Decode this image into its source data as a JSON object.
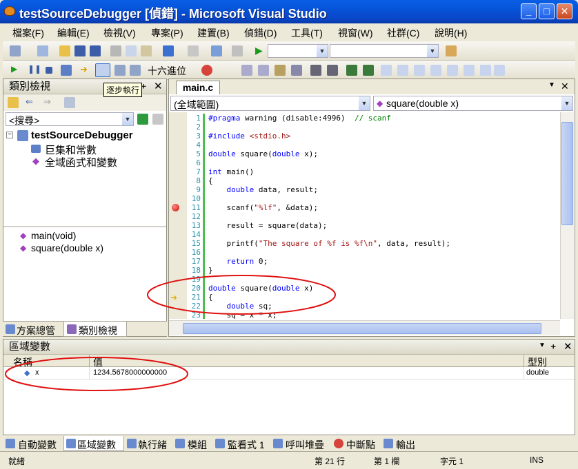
{
  "window": {
    "title": "testSourceDebugger [偵錯] - Microsoft Visual Studio"
  },
  "menu": [
    "檔案(F)",
    "編輯(E)",
    "檢視(V)",
    "專案(P)",
    "建置(B)",
    "偵錯(D)",
    "工具(T)",
    "視窗(W)",
    "社群(C)",
    "說明(H)"
  ],
  "debug_toolbar": {
    "hex_label": "十六進位",
    "tooltip": "逐步執行"
  },
  "class_view": {
    "title": "類別檢視",
    "search_placeholder": "<搜尋>",
    "tree": {
      "root": "testSourceDebugger",
      "child1": "巨集和常數",
      "child2": "全域函式和變數"
    },
    "members": [
      "main(void)",
      "square(double x)"
    ],
    "bottom_tabs": [
      "方案總管",
      "類別檢視"
    ]
  },
  "editor": {
    "tab": "main.c",
    "scope": "(全域範圍)",
    "function": "square(double x)",
    "lines": [
      {
        "n": "1",
        "t": "#pragma warning (disable:4996)  // scanf"
      },
      {
        "n": "2",
        "t": ""
      },
      {
        "n": "3",
        "t": "#include <stdio.h>"
      },
      {
        "n": "4",
        "t": ""
      },
      {
        "n": "5",
        "t": "double square(double x);"
      },
      {
        "n": "6",
        "t": ""
      },
      {
        "n": "7",
        "t": "int main()"
      },
      {
        "n": "8",
        "t": "{"
      },
      {
        "n": "9",
        "t": "    double data, result;"
      },
      {
        "n": "10",
        "t": ""
      },
      {
        "n": "11",
        "t": "    scanf(\"%lf\", &data);"
      },
      {
        "n": "12",
        "t": ""
      },
      {
        "n": "13",
        "t": "    result = square(data);"
      },
      {
        "n": "14",
        "t": ""
      },
      {
        "n": "15",
        "t": "    printf(\"The square of %f is %f\\n\", data, result);"
      },
      {
        "n": "16",
        "t": ""
      },
      {
        "n": "17",
        "t": "    return 0;"
      },
      {
        "n": "18",
        "t": "}"
      },
      {
        "n": "19",
        "t": ""
      },
      {
        "n": "20",
        "t": "double square(double x)"
      },
      {
        "n": "21",
        "t": "{"
      },
      {
        "n": "22",
        "t": "    double sq;"
      },
      {
        "n": "23",
        "t": "    sq = x * x;"
      }
    ]
  },
  "locals": {
    "title": "區域變數",
    "col_name": "名稱",
    "col_value": "值",
    "col_type": "型別",
    "rows": [
      {
        "name": "x",
        "value": "1234.5678000000000",
        "type": "double"
      }
    ]
  },
  "bottom_tabs": [
    "自動變數",
    "區域變數",
    "執行緒",
    "模組",
    "監看式 1",
    "呼叫堆疊",
    "中斷點",
    "輸出"
  ],
  "status": {
    "ready": "就緒",
    "line": "第 21 行",
    "col": "第 1 欄",
    "ch": "字元 1",
    "mode": "INS"
  }
}
